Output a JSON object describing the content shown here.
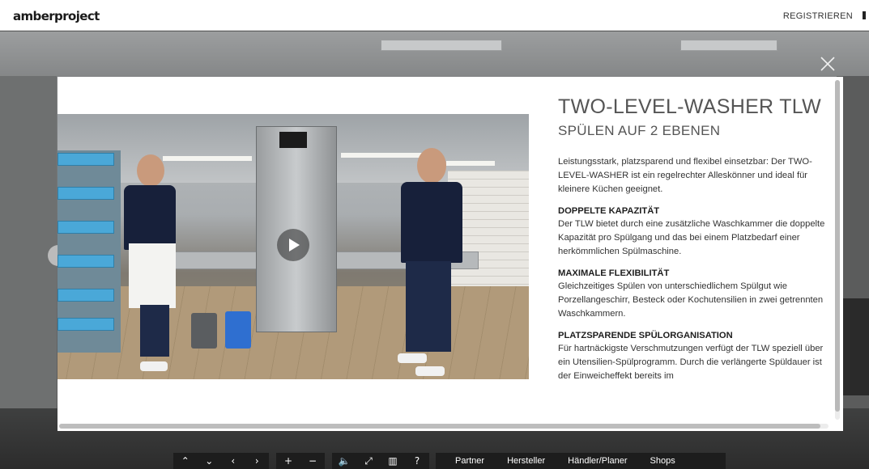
{
  "header": {
    "logo": "amberproject",
    "register_label": "REGISTRIEREN"
  },
  "modal": {
    "title": "TWO-LEVEL-WASHER TLW",
    "subtitle": "SPÜLEN AUF 2 EBENEN",
    "intro": "Leistungsstark, platzsparend und flexibel einsetzbar: Der TWO-LEVEL-WASHER ist ein regelrechter Alleskönner und ideal für kleinere Küchen geeignet.",
    "sections": [
      {
        "heading": "DOPPELTE KAPAZITÄT",
        "body": "Der TLW bietet durch eine zusätzliche Waschkammer die doppelte Kapazität pro Spülgang und das bei einem Platzbedarf einer herkömmlichen Spülmaschine."
      },
      {
        "heading": "MAXIMALE FLEXIBILITÄT",
        "body": "Gleichzeitiges Spülen von unterschiedlichem Spülgut wie Porzellangeschirr, Besteck oder Kochutensilien in zwei getrennten Waschkammern."
      },
      {
        "heading": "PLATZSPARENDE SPÜLORGANISATION",
        "body": "Für hartnäckigste Verschmutzungen verfügt der TLW speziell über ein Utensilien-Spülprogramm. Durch die verlängerte Spüldauer ist der Einweicheffekt bereits im"
      }
    ]
  },
  "toolbar": {
    "controls": [
      {
        "name": "tilt-up-button",
        "icon": "chevron-up-icon",
        "glyph": "⌃"
      },
      {
        "name": "tilt-down-button",
        "icon": "chevron-down-icon",
        "glyph": "⌄"
      },
      {
        "name": "pan-left-button",
        "icon": "chevron-left-icon",
        "glyph": "‹"
      },
      {
        "name": "pan-right-button",
        "icon": "chevron-right-icon",
        "glyph": "›"
      }
    ],
    "zoom": [
      {
        "name": "zoom-in-button",
        "icon": "plus-icon",
        "glyph": "+"
      },
      {
        "name": "zoom-out-button",
        "icon": "minus-icon",
        "glyph": "−"
      }
    ],
    "tools": [
      {
        "name": "sound-button",
        "icon": "speaker-icon",
        "glyph": "🔈"
      },
      {
        "name": "fullscreen-button",
        "icon": "fullscreen-icon",
        "glyph": "⤢"
      },
      {
        "name": "map-button",
        "icon": "map-icon",
        "glyph": "▥"
      },
      {
        "name": "help-button",
        "icon": "help-icon",
        "glyph": "?"
      }
    ],
    "links": [
      "Partner",
      "Hersteller",
      "Händler/Planer",
      "Shops"
    ]
  },
  "colors": {
    "toolbar_bg": "#1d1d1d",
    "modal_bg": "#ffffff",
    "heading_text": "#555555"
  }
}
